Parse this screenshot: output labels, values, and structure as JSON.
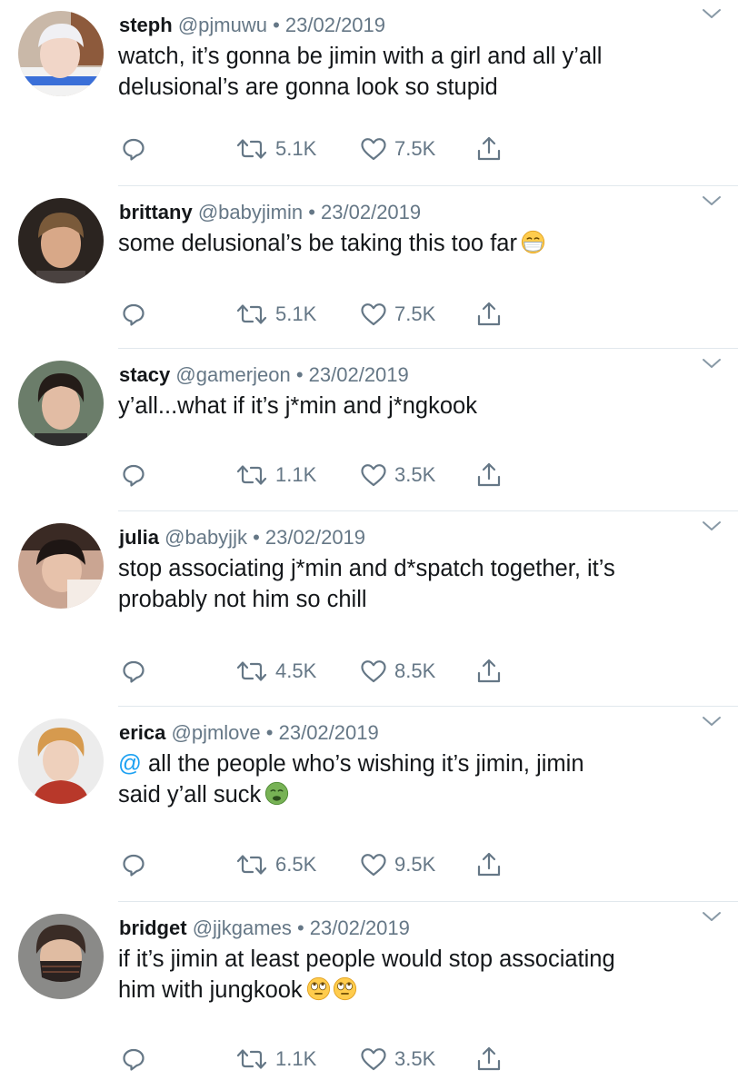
{
  "tweets": [
    {
      "name": "steph",
      "handle": "@pjmuwu",
      "sep": "•",
      "date": "23/02/2019",
      "text_line1": "watch, it’s gonna be jimin with a girl and all y’all",
      "text_line2": "delusional’s are gonna look so stupid",
      "retweets": "5.1K",
      "likes": "7.5K"
    },
    {
      "name": "brittany",
      "handle": "@babyjimin",
      "sep": "•",
      "date": "23/02/2019",
      "text_line1": "some delusional’s be taking this too far",
      "emoji": "face-with-medical-mask",
      "retweets": "5.1K",
      "likes": "7.5K"
    },
    {
      "name": "stacy",
      "handle": "@gamerjeon",
      "sep": "•",
      "date": "23/02/2019",
      "text_line1": "y’all...what if it’s j*min and j*ngkook",
      "retweets": "1.1K",
      "likes": "3.5K"
    },
    {
      "name": "julia",
      "handle": "@babyjjk",
      "sep": "•",
      "date": "23/02/2019",
      "text_line1": "stop associating j*min and d*spatch together, it’s",
      "text_line2": "probably not him so chill",
      "retweets": "4.5K",
      "likes": "8.5K"
    },
    {
      "name": "erica",
      "handle": "@pjmlove",
      "sep": "•",
      "date": "23/02/2019",
      "mention": "@",
      "text_line1": " all the people who’s wishing it’s jimin, jimin",
      "text_line2": "said y’all suck",
      "emoji": "nauseated-face",
      "retweets": "6.5K",
      "likes": "9.5K"
    },
    {
      "name": "bridget",
      "handle": "@jjkgames",
      "sep": "•",
      "date": "23/02/2019",
      "text_line1": "if it’s jimin at least people would stop associating",
      "text_line2": "him with jungkook",
      "emoji": "face-with-rolling-eyes",
      "retweets": "1.1K",
      "likes": "3.5K"
    }
  ],
  "icons": [
    "reply-icon",
    "retweet-icon",
    "like-icon",
    "share-icon",
    "chevron-down-icon"
  ],
  "colors": {
    "text": "#14171a",
    "secondary": "#657786",
    "mention": "#1da1f2",
    "divider": "#e1e8ed"
  }
}
